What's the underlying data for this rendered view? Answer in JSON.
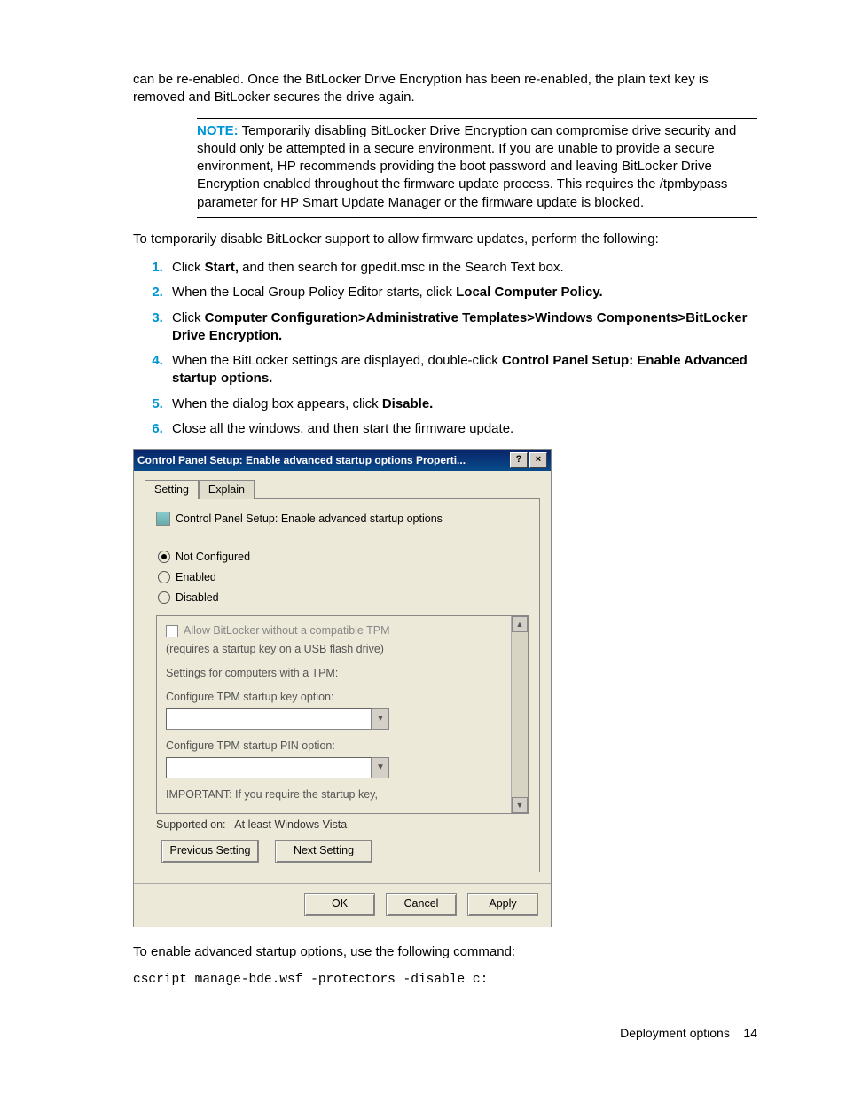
{
  "intro_para": "can be re-enabled. Once the BitLocker Drive Encryption has been re-enabled, the plain text key is removed and BitLocker secures the drive again.",
  "note": {
    "label": "NOTE:",
    "text": "Temporarily disabling BitLocker Drive Encryption can compromise drive security and should only be attempted in a secure environment. If you are unable to provide a secure environment, HP recommends providing the boot password and leaving BitLocker Drive Encryption enabled throughout the firmware update process. This requires the /tpmbypass parameter for HP Smart Update Manager or the firmware update is blocked."
  },
  "lead_in": "To temporarily disable BitLocker support to allow firmware updates, perform the following:",
  "steps": [
    {
      "pre": "Click ",
      "bold": "Start,",
      "post": " and then search for gpedit.msc in the Search Text box."
    },
    {
      "pre": "When the Local Group Policy Editor starts, click ",
      "bold": "Local Computer Policy.",
      "post": ""
    },
    {
      "pre": "Click ",
      "bold": "Computer Configuration>Administrative Templates>Windows Components>BitLocker Drive Encryption.",
      "post": ""
    },
    {
      "pre": "When the BitLocker settings are displayed, double-click ",
      "bold": "Control Panel Setup: Enable Advanced startup options.",
      "post": ""
    },
    {
      "pre": "When the dialog box appears, click ",
      "bold": "Disable.",
      "post": ""
    },
    {
      "pre": "Close all the windows, and then start the firmware update.",
      "bold": "",
      "post": ""
    }
  ],
  "dialog": {
    "title": "Control Panel Setup: Enable advanced startup options Properti...",
    "tabs": {
      "setting": "Setting",
      "explain": "Explain"
    },
    "setting_name": "Control Panel Setup: Enable advanced startup options",
    "radios": {
      "not_configured": "Not Configured",
      "enabled": "Enabled",
      "disabled": "Disabled",
      "selected": "not_configured"
    },
    "options": {
      "allow_no_tpm": "Allow BitLocker without a compatible TPM",
      "allow_no_tpm_sub": "(requires a startup key on a USB flash drive)",
      "settings_tpm": "Settings for computers with a TPM:",
      "cfg_key": "Configure TPM startup key option:",
      "cfg_pin": "Configure TPM startup PIN option:",
      "important": "IMPORTANT: If you require the startup key,"
    },
    "supported_label": "Supported on:",
    "supported_value": "At least Windows Vista",
    "nav": {
      "prev": "Previous Setting",
      "next": "Next Setting"
    },
    "buttons": {
      "ok": "OK",
      "cancel": "Cancel",
      "apply": "Apply"
    },
    "title_buttons": {
      "help": "?",
      "close": "×"
    }
  },
  "after_dialog": "To enable advanced startup options, use the following command:",
  "command": "cscript manage-bde.wsf -protectors -disable c:",
  "footer": {
    "section": "Deployment options",
    "page": "14"
  }
}
